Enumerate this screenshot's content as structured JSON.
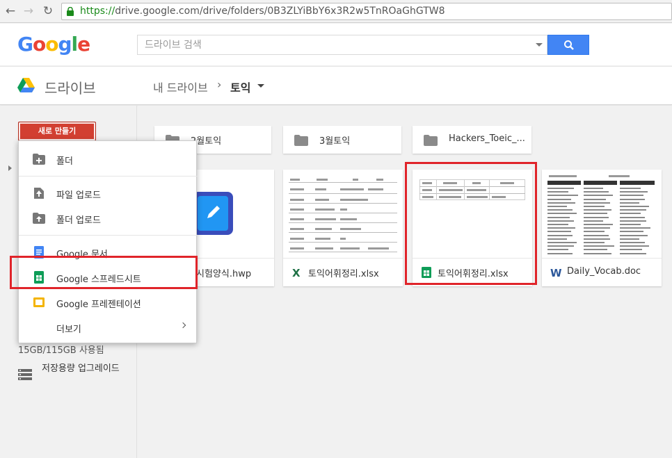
{
  "browser": {
    "url_scheme": "https://",
    "url_rest": "drive.google.com/drive/folders/0B3ZLYiBbY6x3R2w5TnROaGhGTW8"
  },
  "header": {
    "logo_text": "Google",
    "search_placeholder": "드라이브 검색"
  },
  "drive": {
    "title": "드라이브",
    "breadcrumb_root": "내 드라이브",
    "breadcrumb_sep": "›",
    "breadcrumb_current": "토익"
  },
  "sidebar": {
    "new_label": "새로 만들기",
    "storage_label": "15GB/115GB 사용됨",
    "upgrade_label": "저장용량 업그레이드"
  },
  "menu": {
    "items": [
      {
        "label": "폴더",
        "icon": "new-folder-icon"
      },
      {
        "label": "파일 업로드",
        "icon": "file-upload-icon"
      },
      {
        "label": "폴더 업로드",
        "icon": "folder-upload-icon"
      },
      {
        "label": "Google 문서",
        "icon": "google-docs-icon"
      },
      {
        "label": "Google 스프레드시트",
        "icon": "google-sheets-icon"
      },
      {
        "label": "Google 프레젠테이션",
        "icon": "google-slides-icon"
      },
      {
        "label": "더보기",
        "icon": "chevron-right-icon"
      }
    ]
  },
  "folders": [
    {
      "name": "2월토익"
    },
    {
      "name": "3월토익"
    },
    {
      "name": "Hackers_Toeic_..."
    }
  ],
  "files": [
    {
      "name": "시험양식.hwp",
      "type": "hwp"
    },
    {
      "name": "토익어휘정리.xlsx",
      "type": "excel"
    },
    {
      "name": "토익어휘정리.xlsx",
      "type": "sheets"
    },
    {
      "name": "Daily_Vocab.doc",
      "type": "word"
    }
  ],
  "colors": {
    "new_button": "#d23f31",
    "search_button": "#4285f4",
    "highlight": "#e0242a",
    "sheets_green": "#0f9d58",
    "docs_blue": "#4285f4",
    "slides_yellow": "#f4b400"
  }
}
